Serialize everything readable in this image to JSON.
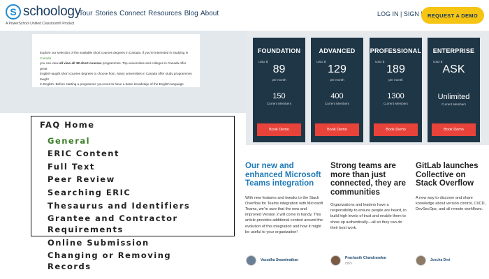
{
  "header": {
    "logo_letter": "S",
    "logo_text": "schoology",
    "logo_tagline": "A PowerSchool Unified Classroom® Product",
    "nav": "Tour Stories Connect Resources Blog About",
    "login": "LOG IN | SIGN UP",
    "cta": "REQUEST A DEMO"
  },
  "description": {
    "line1a": "Explore our selection of the available short courses degrees in Canada. If you're interested in studying in ",
    "line1b": "Canada",
    "line2a": "you can view ",
    "line2b": "all view all 38 short courses",
    "line2c": " programmes. Top universities and colleges in Canada offer great",
    "line3": "English-taught short courses degrees to choose from. Many universities in Canada offer study programmes taught",
    "line4": "in English. Before starting a programme you need to have a basic knowledge of the English language."
  },
  "plans": [
    {
      "name": "FOUNDATION",
      "currency": "USD $",
      "price": "89",
      "per": "per month",
      "members": "150",
      "members_label": "Current Members",
      "button": "Book Demo"
    },
    {
      "name": "ADVANCED",
      "currency": "USD $",
      "price": "129",
      "per": "per month",
      "members": "400",
      "members_label": "Current Members",
      "button": "Book Demo"
    },
    {
      "name": "PROFESSIONAL",
      "currency": "USD $",
      "price": "189",
      "per": "per month",
      "members": "1300",
      "members_label": "Current Members",
      "button": "Book Demo"
    },
    {
      "name": "ENTERPRISE",
      "currency": "USD $",
      "price": "ASK",
      "per": "",
      "members": "Unlimited",
      "members_label": "Current Members",
      "button": "Book Demo"
    }
  ],
  "faq": {
    "home": "FAQ Home",
    "items": [
      "General",
      "ERIC Content",
      "Full Text",
      "Peer Review",
      "Searching ERIC",
      "Thesaurus and Identifiers",
      "Grantee and Contractor",
      "Requirements",
      "Online Submission",
      "Changing or Removing",
      "Records"
    ]
  },
  "articles": [
    {
      "title": "Our new and enhanced Microsoft Teams integration",
      "body": "With new features and tweaks to the Stack Overflow for Teams integration with Microsoft Teams, we're sure that the new and improved Version 2 will come in handy. This article provides additional context around the evolution of this integration and how it might be useful to your organization!",
      "author": "Vasudha Swaminathan",
      "role": ""
    },
    {
      "title": "Strong teams are more than just connected, they are communities",
      "body": "Organizations and leaders have a responsibility to ensure people are heard, to build high levels of trust and enable them to show up authentically—all so they can do their best work.",
      "author": "Prashanth Chandrasekar",
      "role": "CEO"
    },
    {
      "title": "GitLab launches Collective on Stack Overflow",
      "body": "A new way to discover and share knowledge about version control, CI/CD, DevSecOps, and all remote workflows.",
      "author": "Joscha Drei",
      "role": ""
    }
  ],
  "colors": {
    "brand_blue": "#1b8ad3",
    "cta_yellow": "#f6c413",
    "plan_navy": "#1f3646",
    "book_red": "#e8433a",
    "faq_green": "#3b7d26",
    "article_blue": "#1f7ab8"
  }
}
